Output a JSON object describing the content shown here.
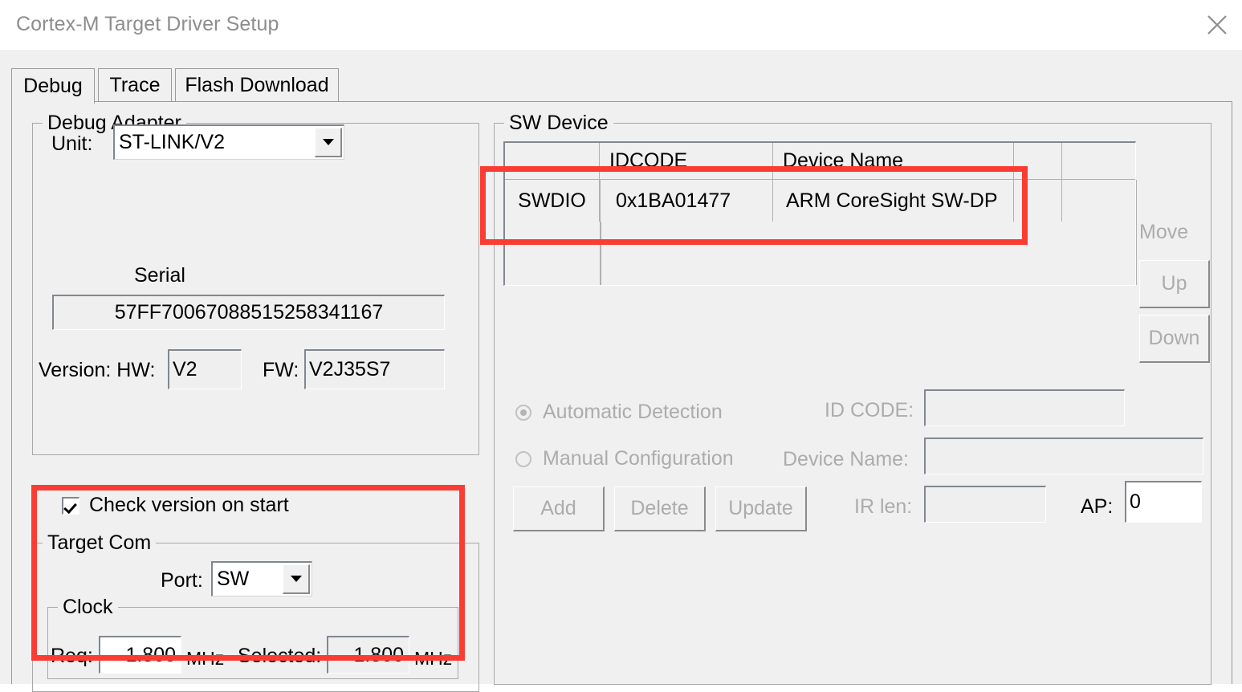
{
  "window": {
    "title": "Cortex-M Target Driver Setup",
    "close_icon": "close-icon"
  },
  "tabs": [
    {
      "label": "Debug",
      "selected": true
    },
    {
      "label": "Trace",
      "selected": false
    },
    {
      "label": "Flash Download",
      "selected": false
    }
  ],
  "debug_adapter": {
    "legend": "Debug Adapter",
    "unit_label": "Unit:",
    "unit_value": "ST-LINK/V2",
    "serial_label": "Serial",
    "serial_value": "57FF70067088515258341167",
    "version_label": "Version: HW:",
    "hw_value": "V2",
    "fw_label": "FW:",
    "fw_value": "V2J35S7",
    "check_version_label": "Check version on start",
    "check_version_checked": true
  },
  "target_com": {
    "legend": "Target Com",
    "port_label": "Port:",
    "port_value": "SW",
    "clock": {
      "legend": "Clock",
      "req_label": "Req:",
      "req_value": "1.800",
      "req_unit": "MHz",
      "selected_label": "Selected:",
      "selected_value": "1.800",
      "selected_unit": "MHz"
    }
  },
  "sw_device": {
    "legend": "SW Device",
    "columns": [
      "",
      "IDCODE",
      "Device Name",
      "",
      ""
    ],
    "rows": [
      {
        "port": "SWDIO",
        "idcode": "0x1BA01477",
        "device_name": "ARM CoreSight SW-DP"
      }
    ],
    "move_label": "Move",
    "up_label": "Up",
    "down_label": "Down",
    "automatic_detection_label": "Automatic Detection",
    "automatic_detection_selected": true,
    "manual_configuration_label": "Manual Configuration",
    "manual_configuration_selected": false,
    "add_label": "Add",
    "delete_label": "Delete",
    "update_label": "Update",
    "id_code_label": "ID CODE:",
    "id_code_value": "",
    "device_name_label": "Device Name:",
    "device_name_value": "",
    "ir_len_label": "IR len:",
    "ir_len_value": "",
    "ap_label": "AP:",
    "ap_value": "0"
  },
  "annotations": {
    "highlight_color": "#fa3c32",
    "boxes": [
      "sw-device-row-highlight",
      "target-com-highlight"
    ]
  }
}
